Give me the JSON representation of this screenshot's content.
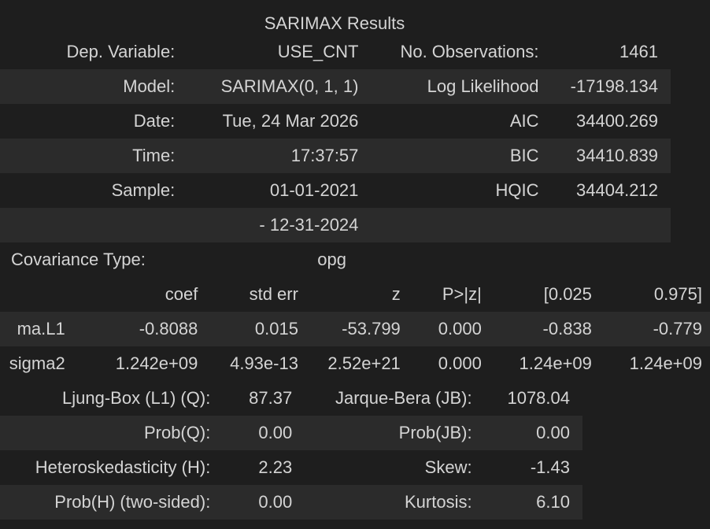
{
  "title": "SARIMAX Results",
  "summary": {
    "rows": [
      [
        "Dep. Variable:",
        "USE_CNT",
        "No. Observations:",
        "1461"
      ],
      [
        "Model:",
        "SARIMAX(0, 1, 1)",
        "Log Likelihood",
        "-17198.134"
      ],
      [
        "Date:",
        "Tue, 24 Mar 2026",
        "AIC",
        "34400.269"
      ],
      [
        "Time:",
        "17:37:57",
        "BIC",
        "34410.839"
      ],
      [
        "Sample:",
        "01-01-2021",
        "HQIC",
        "34404.212"
      ],
      [
        "",
        "- 12-31-2024",
        "",
        ""
      ]
    ]
  },
  "covariance": {
    "label": "Covariance Type:",
    "value": "opg"
  },
  "coefficients": {
    "headers": [
      "",
      "coef",
      "std err",
      "z",
      "P>|z|",
      "[0.025",
      "0.975]"
    ],
    "rows": [
      [
        "ma.L1",
        "-0.8088",
        "0.015",
        "-53.799",
        "0.000",
        "-0.838",
        "-0.779"
      ],
      [
        "sigma2",
        "1.242e+09",
        "4.93e-13",
        "2.52e+21",
        "0.000",
        "1.24e+09",
        "1.24e+09"
      ]
    ]
  },
  "diagnostics": {
    "rows": [
      [
        "Ljung-Box (L1) (Q):",
        "87.37",
        "Jarque-Bera (JB):",
        "1078.04"
      ],
      [
        "Prob(Q):",
        "0.00",
        "Prob(JB):",
        "0.00"
      ],
      [
        "Heteroskedasticity (H):",
        "2.23",
        "Skew:",
        "-1.43"
      ],
      [
        "Prob(H) (two-sided):",
        "0.00",
        "Kurtosis:",
        "6.10"
      ]
    ]
  }
}
